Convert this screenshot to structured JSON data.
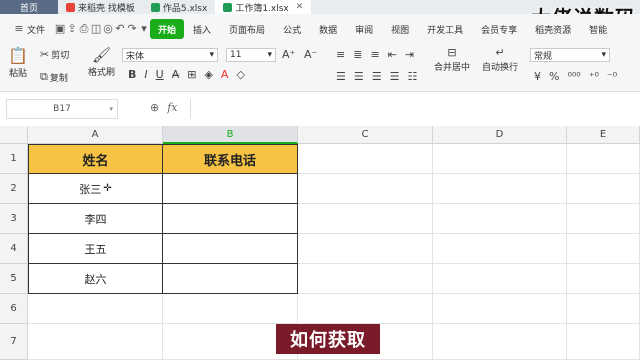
{
  "tabs": [
    {
      "label": "首页",
      "type": "home"
    },
    {
      "label": "来稻壳 找模板",
      "icon": "red"
    },
    {
      "label": "作品5.xlsx",
      "icon": "green"
    },
    {
      "label": "工作簿1.xlsx",
      "icon": "green",
      "active": true
    }
  ],
  "brand": "大佬说数码",
  "menu": {
    "file": "文件",
    "items": [
      "开始",
      "插入",
      "页面布局",
      "公式",
      "数据",
      "审阅",
      "视图",
      "开发工具",
      "会员专享",
      "稻壳资源",
      "智能"
    ]
  },
  "ribbon": {
    "cut": "剪切",
    "paste": "粘贴",
    "copy": "复制",
    "format_painter": "格式刷",
    "font_name": "宋体",
    "font_size": "11",
    "merge": "合并居中",
    "wrap": "自动换行",
    "number_format": "常规"
  },
  "formula": {
    "cell_ref": "B17",
    "fx": "fx",
    "value": ""
  },
  "sheet": {
    "columns": [
      "A",
      "B",
      "C",
      "D",
      "E"
    ],
    "rows": [
      "1",
      "2",
      "3",
      "4",
      "5",
      "6",
      "7"
    ],
    "header": [
      "姓名",
      "联系电话"
    ],
    "names": [
      "张三",
      "李四",
      "王五",
      "赵六"
    ]
  },
  "caption": "如何获取",
  "colors": {
    "header_fill": "#f6c344",
    "accent": "#1aad19",
    "caption_bg": "#7a1b2a"
  }
}
